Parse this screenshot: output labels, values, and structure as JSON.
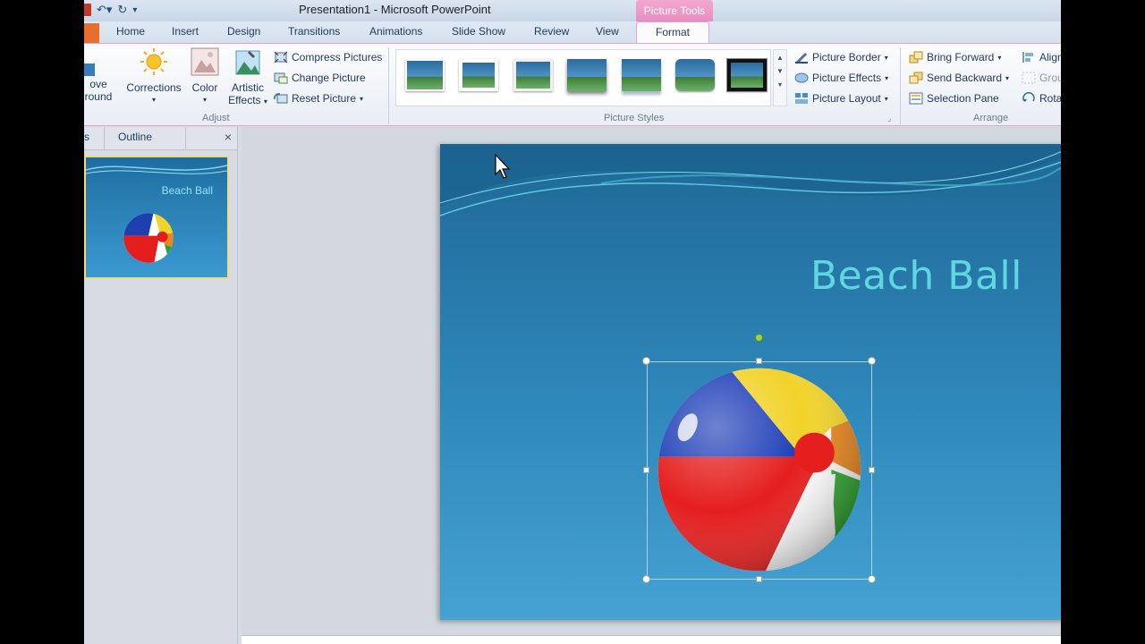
{
  "window": {
    "title": "Presentation1  -  Microsoft PowerPoint",
    "context_tab_group": "Picture Tools"
  },
  "tabs": [
    "Home",
    "Insert",
    "Design",
    "Transitions",
    "Animations",
    "Slide Show",
    "Review",
    "View"
  ],
  "active_tab": "Format",
  "ribbon": {
    "adjust": {
      "remove_background_partial": [
        "ove",
        "round"
      ],
      "corrections": "Corrections",
      "color": "Color",
      "artistic_effects": [
        "Artistic",
        "Effects"
      ],
      "compress": "Compress Pictures",
      "change": "Change Picture",
      "reset": "Reset Picture",
      "label": "Adjust"
    },
    "picture_styles": {
      "label": "Picture Styles",
      "border": "Picture Border",
      "effects": "Picture Effects",
      "layout": "Picture Layout"
    },
    "arrange": {
      "label": "Arrange",
      "bring_forward": "Bring Forward",
      "send_backward": "Send Backward",
      "selection_pane": "Selection Pane",
      "align": "Align",
      "group": "Grou",
      "rotate": "Rota"
    }
  },
  "panel": {
    "slides_tab_partial": "s",
    "outline_tab": "Outline",
    "close": "×",
    "thumb_title": "Beach Ball"
  },
  "slide": {
    "title": "Beach Ball"
  },
  "colors": {
    "accent_pink": "#e88ec0",
    "title_cyan": "#5fd6e0",
    "file_tab": "#e76e2c"
  }
}
